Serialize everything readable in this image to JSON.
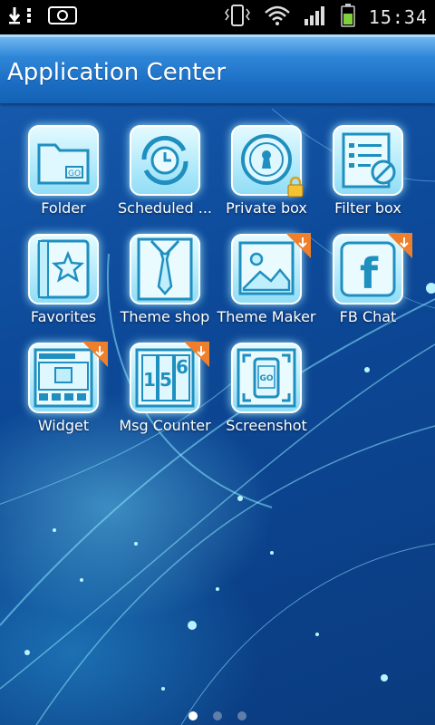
{
  "status_bar": {
    "time": "15:34",
    "icons": [
      "usb-download-icon",
      "screenshot-icon",
      "vibrate-icon",
      "wifi-icon",
      "signal-icon",
      "battery-icon"
    ]
  },
  "header": {
    "title": "Application Center"
  },
  "apps": [
    {
      "label": "Folder",
      "icon": "folder-icon"
    },
    {
      "label": "Scheduled ...",
      "icon": "clock-icon"
    },
    {
      "label": "Private box",
      "icon": "keyhole-icon",
      "badge": "lock-icon"
    },
    {
      "label": "Filter box",
      "icon": "filter-list-icon"
    },
    {
      "label": "Favorites",
      "icon": "star-book-icon"
    },
    {
      "label": "Theme shop",
      "icon": "shirt-tie-icon"
    },
    {
      "label": "Theme Maker",
      "icon": "picture-icon",
      "badge": "download-badge-icon"
    },
    {
      "label": "FB Chat",
      "icon": "facebook-icon",
      "badge": "download-badge-icon"
    },
    {
      "label": "Widget",
      "icon": "widget-icon",
      "badge": "download-badge-icon"
    },
    {
      "label": "Msg Counter",
      "icon": "counter-icon",
      "badge": "download-badge-icon"
    },
    {
      "label": "Screenshot",
      "icon": "phone-screenshot-icon"
    }
  ],
  "pager": {
    "pages": 3,
    "current": 1
  },
  "colors": {
    "title_bar": "#1a6dc3",
    "icon_tile": "#b5ebfb",
    "background": "#0d4a9a"
  }
}
